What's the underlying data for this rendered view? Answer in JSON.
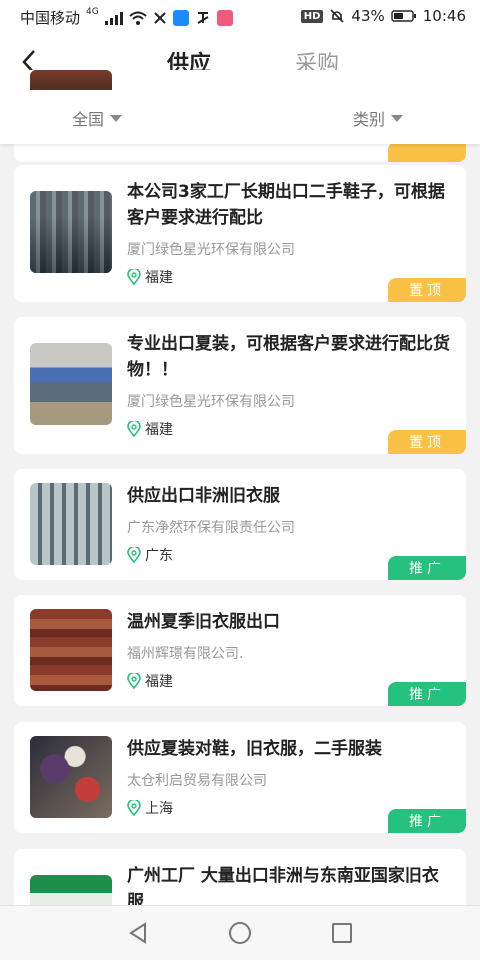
{
  "status_bar": {
    "carrier": "中国移动",
    "network": "4G",
    "hd": "HD",
    "battery": "43%",
    "time": "10:46"
  },
  "header": {
    "tabs": [
      {
        "label": "供应",
        "active": true
      },
      {
        "label": "采购",
        "active": false
      }
    ]
  },
  "filters": {
    "region": "全国",
    "category": "类别"
  },
  "listings": [
    {
      "title": "本公司3家工厂长期出口二手鞋子，可根据客户要求进行配比",
      "company": "厦门绿色星光环保有限公司",
      "location": "福建",
      "tag": "置顶",
      "tag_type": "top",
      "thumb": "bales"
    },
    {
      "title": "专业出口夏装，可根据客户要求进行配比货物！！",
      "company": "厦门绿色星光环保有限公司",
      "location": "福建",
      "tag": "置顶",
      "tag_type": "top",
      "thumb": "warehouse"
    },
    {
      "title": "供应出口非洲旧衣服",
      "company": "广东净然环保有限责任公司",
      "location": "广东",
      "tag": "推广",
      "tag_type": "promo",
      "thumb": "rolls"
    },
    {
      "title": "温州夏季旧衣服出口",
      "company": "福州辉璟有限公司.",
      "location": "福建",
      "tag": "推广",
      "tag_type": "promo",
      "thumb": "brown"
    },
    {
      "title": "供应夏装对鞋，旧衣服，二手服装",
      "company": "太仓利启贸易有限公司",
      "location": "上海",
      "tag": "推广",
      "tag_type": "promo",
      "thumb": "clothes"
    },
    {
      "title": "广州工厂 大量出口非洲与东南亚国家旧衣服",
      "company": "",
      "location": "",
      "tag": "",
      "tag_type": "",
      "thumb": "green"
    }
  ],
  "colors": {
    "accent_green": "#22c37a",
    "tag_top": "#f9c145",
    "tag_promo": "#27c17f"
  }
}
